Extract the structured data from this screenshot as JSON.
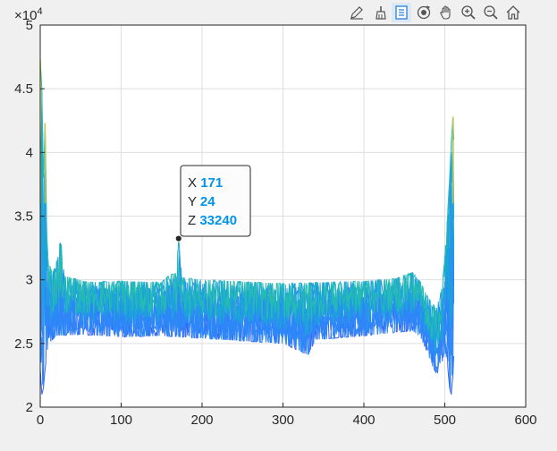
{
  "toolbar": {
    "buttons": [
      {
        "name": "edit-plot-icon"
      },
      {
        "name": "brush-icon"
      },
      {
        "name": "datatip-icon",
        "active": true
      },
      {
        "name": "rotate-3d-icon"
      },
      {
        "name": "pan-icon"
      },
      {
        "name": "zoom-in-icon"
      },
      {
        "name": "zoom-out-icon"
      },
      {
        "name": "home-icon"
      }
    ]
  },
  "axes": {
    "exponent_base": "×10",
    "exponent_power": "4",
    "x_ticks": [
      "0",
      "100",
      "200",
      "300",
      "400",
      "500",
      "600"
    ],
    "y_ticks": [
      "2",
      "2.5",
      "3",
      "3.5",
      "4",
      "4.5",
      "5"
    ],
    "grid": true
  },
  "datatip": {
    "x_label": "X",
    "x_value": "171",
    "y_label": "Y",
    "y_value": "24",
    "z_label": "Z",
    "z_value": "33240",
    "value_color": "#0095e8"
  },
  "chart_data": {
    "type": "line",
    "view": "2-D projection of a surface plot (X vs Z), colored by height",
    "xlim": [
      0,
      600
    ],
    "ylim": [
      20000,
      50000
    ],
    "grid": true,
    "colormap": [
      "#3e26a8",
      "#3d5bf5",
      "#2e87f7",
      "#1ca6d8",
      "#25bdb0",
      "#5cc863",
      "#cac33a",
      "#f9e11f"
    ],
    "data_range": {
      "x": [
        0,
        511
      ],
      "z": [
        21000,
        47300
      ]
    },
    "baseline_band": {
      "x": [
        30,
        460
      ],
      "z": [
        26000,
        29500
      ]
    },
    "envelope_max": [
      [
        0,
        47300
      ],
      [
        2,
        45000
      ],
      [
        4,
        38000
      ],
      [
        6,
        42300
      ],
      [
        8,
        34000
      ],
      [
        10,
        31500
      ],
      [
        15,
        30500
      ],
      [
        22,
        31800
      ],
      [
        25,
        33400
      ],
      [
        30,
        30300
      ],
      [
        60,
        29800
      ],
      [
        100,
        29900
      ],
      [
        150,
        29800
      ],
      [
        160,
        30400
      ],
      [
        168,
        30500
      ],
      [
        171,
        33240
      ],
      [
        175,
        30200
      ],
      [
        200,
        30000
      ],
      [
        300,
        29700
      ],
      [
        400,
        29900
      ],
      [
        440,
        30100
      ],
      [
        460,
        30600
      ],
      [
        470,
        29800
      ],
      [
        480,
        28500
      ],
      [
        490,
        27800
      ],
      [
        497,
        29500
      ],
      [
        502,
        33500
      ],
      [
        506,
        38000
      ],
      [
        508,
        40700
      ],
      [
        510,
        42800
      ],
      [
        511,
        41000
      ]
    ],
    "envelope_min": [
      [
        0,
        23000
      ],
      [
        2,
        21000
      ],
      [
        4,
        21500
      ],
      [
        6,
        23000
      ],
      [
        10,
        25000
      ],
      [
        20,
        25600
      ],
      [
        50,
        25700
      ],
      [
        100,
        25500
      ],
      [
        150,
        25600
      ],
      [
        200,
        25400
      ],
      [
        250,
        25200
      ],
      [
        300,
        25000
      ],
      [
        331,
        24100
      ],
      [
        340,
        25300
      ],
      [
        400,
        25600
      ],
      [
        460,
        26000
      ],
      [
        470,
        25500
      ],
      [
        480,
        24000
      ],
      [
        485,
        23200
      ],
      [
        490,
        22600
      ],
      [
        495,
        23000
      ],
      [
        500,
        24500
      ],
      [
        503,
        23600
      ],
      [
        506,
        21500
      ],
      [
        508,
        21000
      ],
      [
        510,
        22500
      ],
      [
        511,
        24000
      ]
    ],
    "datatip_point": {
      "x": 171,
      "y": 24,
      "z": 33240
    }
  }
}
